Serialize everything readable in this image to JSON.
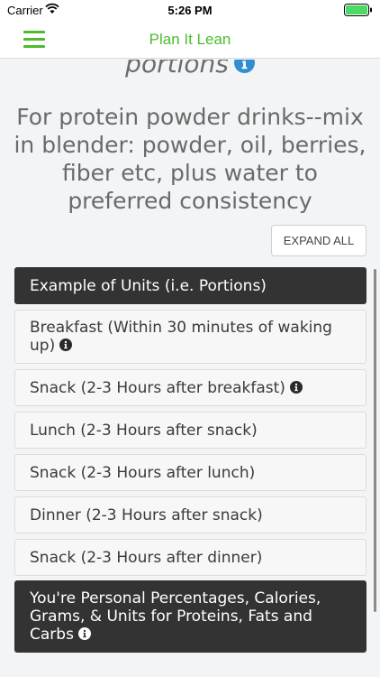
{
  "status_bar": {
    "carrier": "Carrier",
    "time": "5:26 PM"
  },
  "nav": {
    "title": "Plan It Lean"
  },
  "header": {
    "portions_text": "portions",
    "instructions": "For protein powder drinks--mix in blender: powder, oil, berries, fiber etc, plus water to preferred consistency"
  },
  "expand_all_label": "EXPAND ALL",
  "sections": [
    {
      "label": "Example of Units (i.e. Portions)"
    },
    {
      "label": "Breakfast (Within 30 minutes of waking up)",
      "info": true
    },
    {
      "label": "Snack (2-3 Hours after breakfast)",
      "info": true
    },
    {
      "label": "Lunch (2-3 Hours after snack)"
    },
    {
      "label": "Snack (2-3 Hours after lunch)"
    },
    {
      "label": "Dinner (2-3 Hours after snack)"
    },
    {
      "label": "Snack (2-3 Hours after dinner)"
    },
    {
      "label": "You're Personal Percentages, Calories, Grams, & Units for Proteins, Fats and Carbs",
      "info": true
    }
  ],
  "colors": {
    "brand_green": "#4cbb2e",
    "info_blue": "#2f8fd0",
    "dark_section": "#333333"
  },
  "icons": [
    "menu-icon",
    "wifi-icon",
    "battery-icon",
    "info-icon"
  ]
}
